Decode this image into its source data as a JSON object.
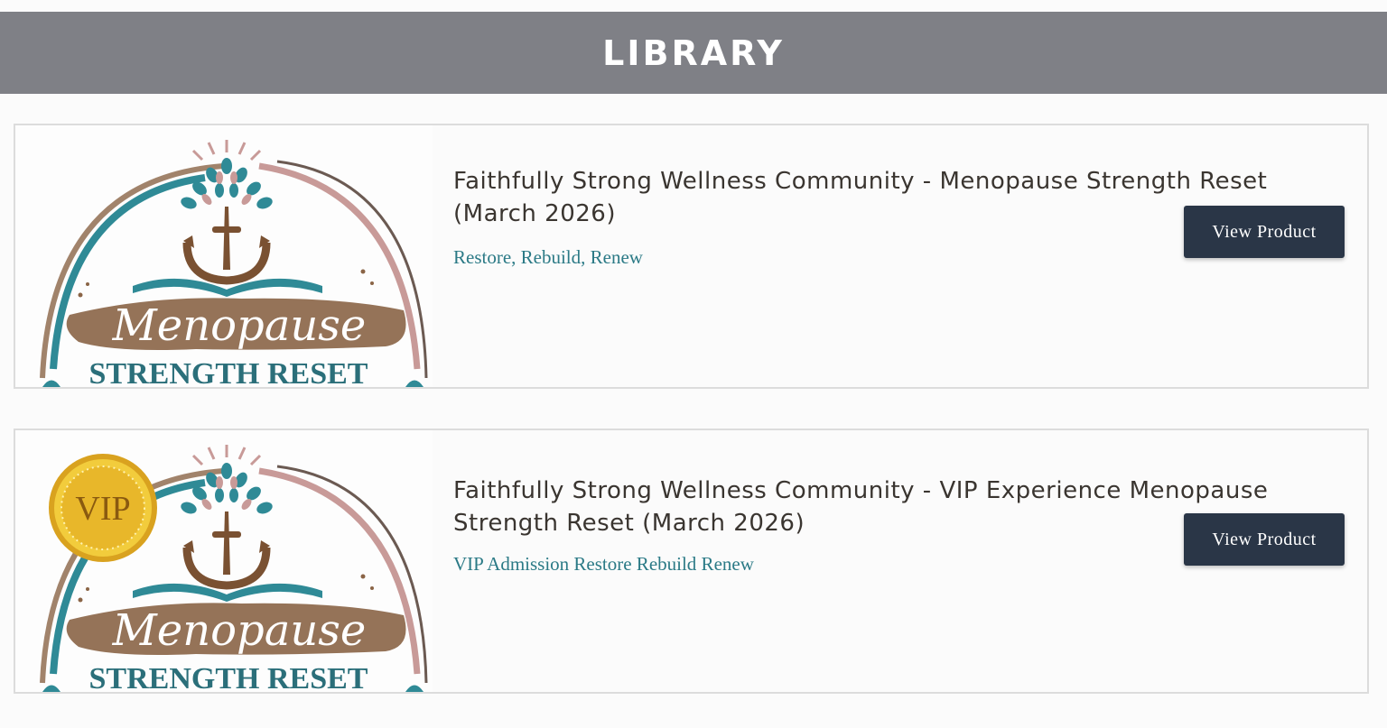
{
  "header": {
    "title": "LIBRARY"
  },
  "products": [
    {
      "title": "Faithfully Strong Wellness Community - Menopause Strength Reset (March 2026)",
      "subtitle": "Restore, Rebuild, Renew",
      "button_label": "View Product",
      "logo": {
        "script": "Menopause",
        "caption": "STRENGTH RESET"
      }
    },
    {
      "title": "Faithfully Strong Wellness Community - VIP Experience Menopause Strength Reset (March 2026)",
      "subtitle": "VIP Admission Restore Rebuild Renew",
      "button_label": "View Product",
      "logo": {
        "script": "Menopause",
        "caption": "STRENGTH RESET",
        "badge": "VIP"
      }
    }
  ],
  "colors": {
    "header_bg": "#7f8086",
    "button_bg": "#2a3647",
    "subtitle": "#2b7a86",
    "logo_teal": "#2f8a96",
    "logo_brown": "#8a6446",
    "logo_pink": "#c89a98",
    "badge_gold": "#e0b42a"
  }
}
